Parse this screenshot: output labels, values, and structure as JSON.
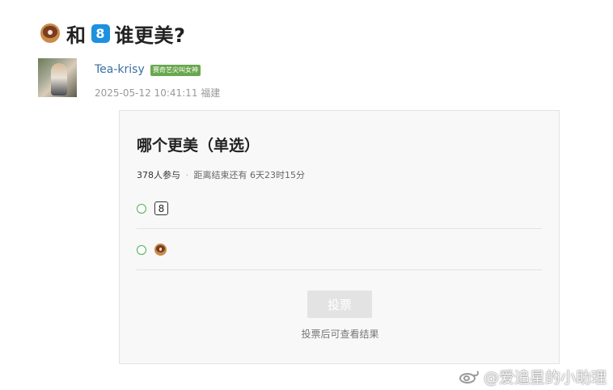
{
  "post": {
    "title_middle": "和",
    "title_keycap": "8",
    "title_end": "谁更美?",
    "title_icon": "donut-emoji-icon"
  },
  "author": {
    "name": "Tea-krisy",
    "badge": "赛奇艺尖叫女神",
    "meta": "2025-05-12 10:41:11 福建"
  },
  "poll": {
    "title": "哪个更美（单选）",
    "participants": "378人参与",
    "separator": "·",
    "deadline": "距离结束还有 6天23时15分",
    "options": [
      {
        "label": "8",
        "icon": "keycap-8-icon"
      },
      {
        "label": "",
        "icon": "donut-emoji-icon"
      }
    ],
    "vote_button": "投票",
    "hint": "投票后可查看结果"
  },
  "watermark": {
    "text": "@爱追星的小助理",
    "icon": "weibo-logo-icon"
  },
  "colors": {
    "accent_green": "#4caf50",
    "badge_green": "#6aa84f",
    "keycap_blue": "#1e90e0",
    "link_blue": "#3a6ea5"
  }
}
